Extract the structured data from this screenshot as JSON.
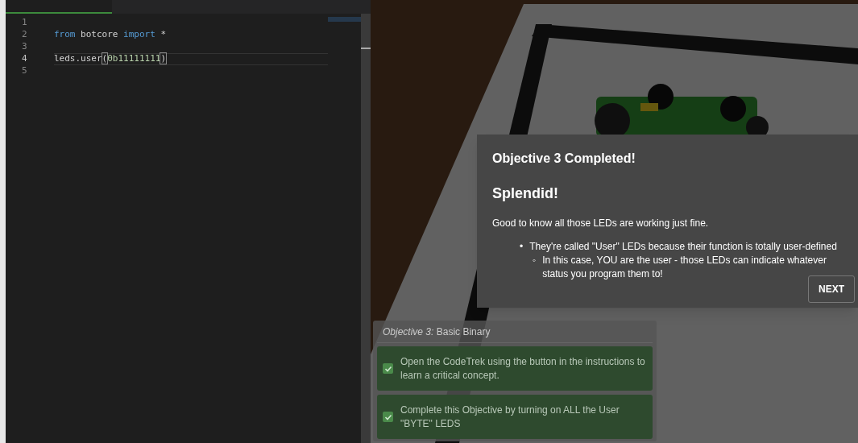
{
  "editor": {
    "lines": [
      {
        "number": "1",
        "current": false
      },
      {
        "number": "2",
        "current": false,
        "tokens": [
          {
            "kind": "keyword",
            "text": "from"
          },
          {
            "kind": "plain",
            "text": " botcore "
          },
          {
            "kind": "keyword",
            "text": "import"
          },
          {
            "kind": "plain",
            "text": " *"
          }
        ]
      },
      {
        "number": "3",
        "current": false
      },
      {
        "number": "4",
        "current": true,
        "tokens": [
          {
            "kind": "plain",
            "text": "leds.user"
          },
          {
            "kind": "bracket",
            "text": "("
          },
          {
            "kind": "number",
            "text": "0b11111111"
          },
          {
            "kind": "bracket",
            "text": ")"
          }
        ]
      },
      {
        "number": "5",
        "current": false
      }
    ]
  },
  "dialog": {
    "title": "Objective 3 Completed!",
    "heading": "Splendid!",
    "intro": "Good to know all those LEDs are working just fine.",
    "bullets": [
      {
        "marker": "•",
        "text": "They're called \"User\" LEDs because their function is totally user-defined",
        "children": [
          {
            "marker": "◦",
            "text": "In this case, YOU are the user - those LEDs can indicate whatever status you program them to!"
          }
        ]
      }
    ],
    "button": "NEXT"
  },
  "objectives": {
    "title": "*Objective 3:* Basic Binary",
    "tasks": [
      {
        "text": "Open the CodeTrek using the button in the instructions to learn a critical concept.",
        "checked": true
      },
      {
        "text": "Complete this Objective by turning on ALL the User \"BYTE\" LEDS",
        "checked": true
      }
    ]
  }
}
